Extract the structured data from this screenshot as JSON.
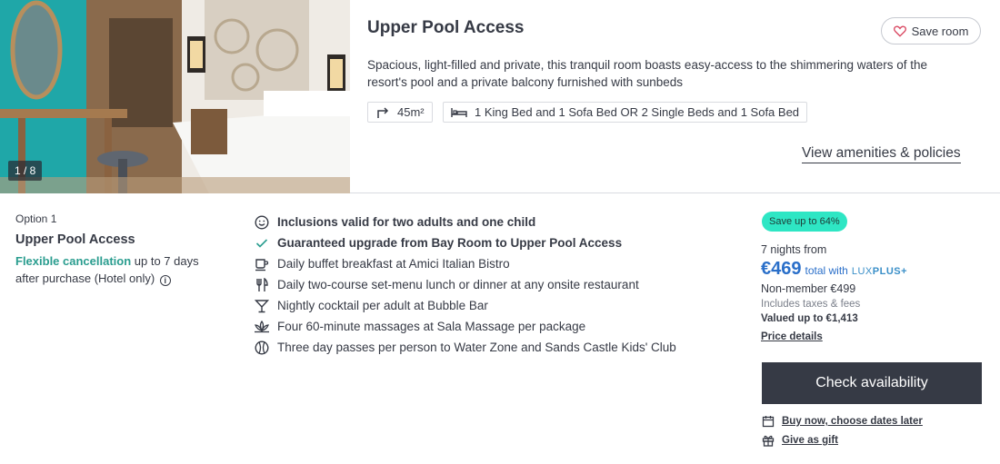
{
  "room": {
    "photo_counter": "1 / 8",
    "title": "Upper Pool Access",
    "save_label": "Save room",
    "description": "Spacious, light-filled and private, this tranquil room boasts easy-access to the shimmering waters of the resort's pool and a private balcony furnished with sunbeds",
    "size": "45m²",
    "beds": "1 King Bed and 1 Sofa Bed OR 2 Single Beds and 1 Sofa Bed",
    "view_amenities": "View amenities & policies"
  },
  "option": {
    "label": "Option 1",
    "title": "Upper Pool Access",
    "cancel_highlight": "Flexible cancellation",
    "cancel_rest": " up to 7 days after purchase (Hotel only)",
    "info_glyph": "i"
  },
  "inclusions": [
    {
      "icon": "smiley-icon",
      "text": "Inclusions valid for two adults and one child",
      "bold": true
    },
    {
      "icon": "check-icon",
      "text": "Guaranteed upgrade from Bay Room to Upper Pool Access",
      "bold": true
    },
    {
      "icon": "coffee-cup-icon",
      "text": "Daily buffet breakfast at Amici Italian Bistro",
      "bold": false
    },
    {
      "icon": "cutlery-icon",
      "text": "Daily two-course set-menu lunch or dinner at any onsite restaurant",
      "bold": false
    },
    {
      "icon": "cocktail-icon",
      "text": "Nightly cocktail per adult at Bubble Bar",
      "bold": false
    },
    {
      "icon": "lotus-icon",
      "text": "Four 60-minute massages at Sala Massage per package",
      "bold": false
    },
    {
      "icon": "ball-icon",
      "text": "Three day passes per person to Water Zone and Sands Castle Kids' Club",
      "bold": false
    }
  ],
  "pricing": {
    "badge": "Save up to 64%",
    "nights": "7 nights from",
    "price": "€469",
    "total_with": "total with",
    "lux": "LUX",
    "plus": "PLUS+",
    "non_member": "Non-member €499",
    "taxes": "Includes taxes & fees",
    "valued": "Valued up to €1,413",
    "price_details": "Price details",
    "check_availability": "Check availability",
    "buy_now": "Buy now, choose dates later",
    "gift": "Give as gift"
  },
  "colors": {
    "text": "#363a45",
    "accent_green": "#2a9d8f",
    "badge_bg": "#2ee6c4",
    "price_blue": "#2a6fc9",
    "button_dark": "#363a45"
  }
}
